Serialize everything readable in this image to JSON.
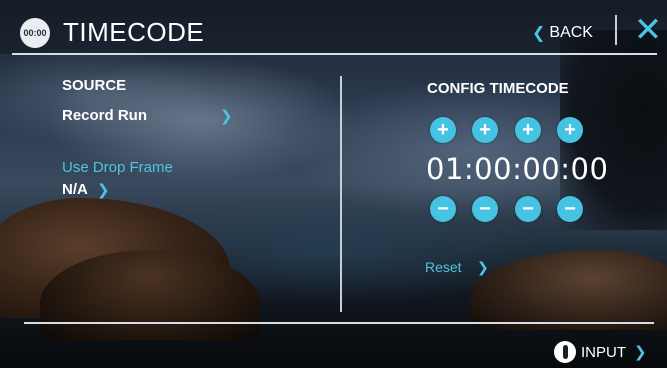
{
  "header": {
    "badge_text": "00:00",
    "title": "TIMECODE",
    "back_label": "BACK",
    "close_symbol": "✕"
  },
  "source": {
    "title": "SOURCE",
    "value": "Record Run"
  },
  "drop_frame": {
    "title": "Use Drop Frame",
    "value": "N/A"
  },
  "config": {
    "title": "CONFIG TIMECODE",
    "timecode": "01:00:00:00",
    "increment_symbol": "+",
    "decrement_symbol": "−",
    "reset_label": "Reset"
  },
  "footer": {
    "input_label": "INPUT"
  },
  "icons": {
    "chevron": "❯",
    "back_chevron": "❮"
  },
  "colors": {
    "accent": "#46c3e2",
    "text": "#ffffff"
  }
}
